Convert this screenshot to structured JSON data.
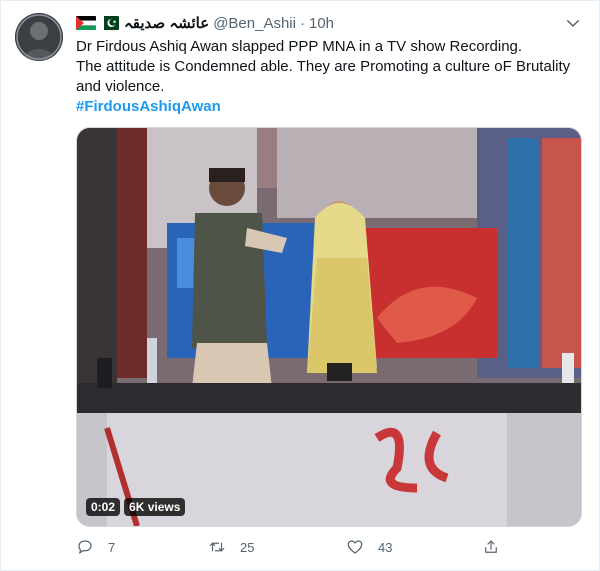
{
  "tweet": {
    "display_name": "عائشہ صدیقہ",
    "handle": "@Ben_Ashii",
    "separator": "·",
    "time": "10h",
    "lines": [
      "Dr Firdous Ashiq Awan slapped PPP MNA in a TV show Recording.",
      "The attitude is Condemned able. They are Promoting a culture oF Brutality",
      "and violence."
    ],
    "hashtag": "#FirdousAshiqAwan",
    "video": {
      "duration": "0:02",
      "views": "6K views"
    },
    "actions": {
      "reply_icon": "reply-icon",
      "reply_count": "7",
      "retweet_icon": "retweet-icon",
      "retweet_count": "25",
      "like_icon": "heart-icon",
      "like_count": "43",
      "share_icon": "share-icon"
    },
    "colors": {
      "link": "#1d9bf0",
      "muted": "#536471",
      "text": "#0f1419"
    }
  }
}
